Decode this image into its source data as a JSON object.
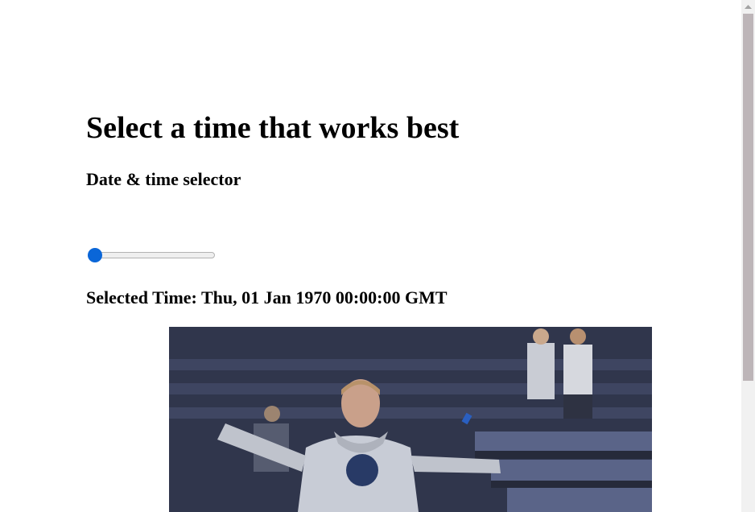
{
  "page": {
    "title": "Select a time that works best",
    "subtitle": "Date & time selector",
    "selected_time_label": "Selected Time: Thu, 01 Jan 1970 00:00:00 GMT"
  },
  "slider": {
    "value_fraction": 0
  },
  "media": {
    "description_icon": "animated-gif"
  },
  "colors": {
    "slider_accent": "#0a66d8",
    "scroll_thumb": "#bdb5b8"
  }
}
